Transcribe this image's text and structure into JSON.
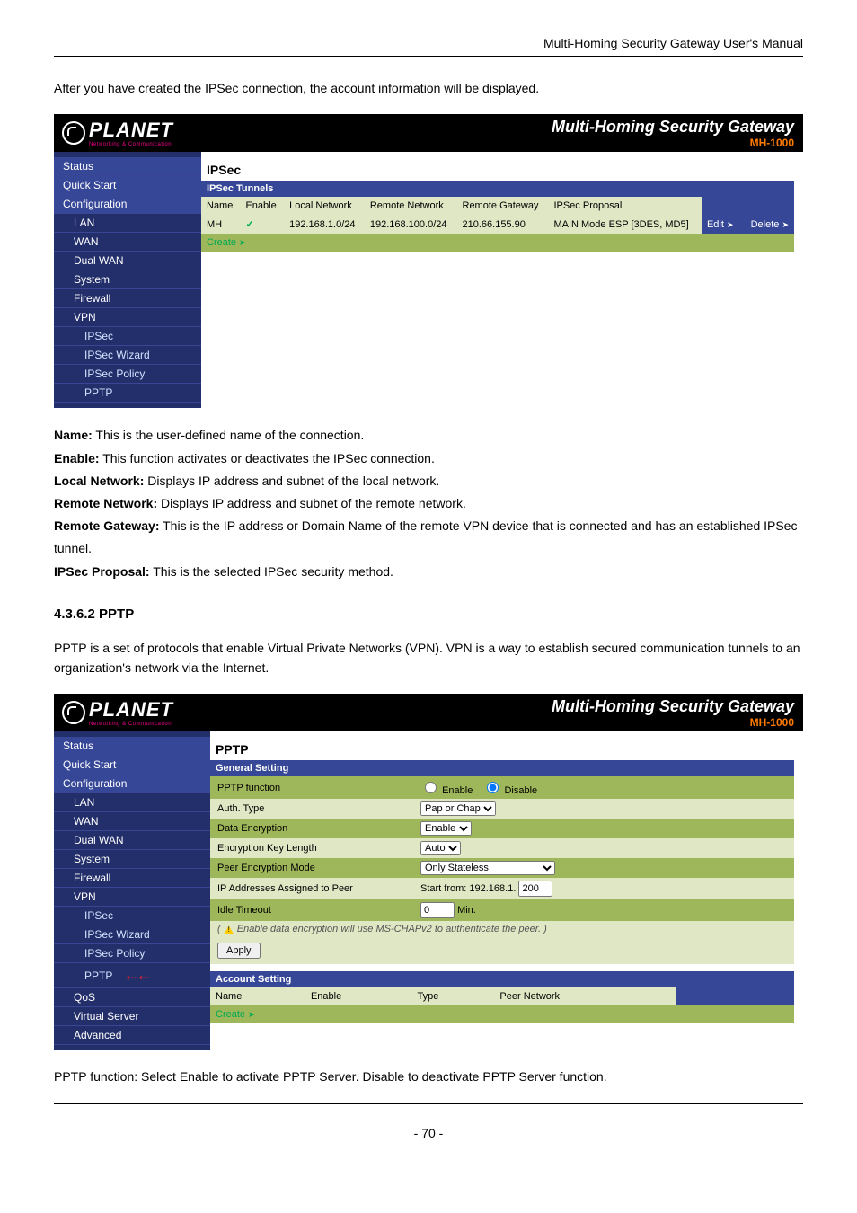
{
  "page_header": "Multi-Homing Security Gateway User's Manual",
  "intro_para": "After you have created the IPSec connection, the account information will be displayed.",
  "app_title": "Multi-Homing Security Gateway",
  "model": "MH-1000",
  "logo_text": "PLANET",
  "logo_sub": "Networking & Communication",
  "sidebar": {
    "status": "Status",
    "quick": "Quick Start",
    "config": "Configuration",
    "lan": "LAN",
    "wan": "WAN",
    "dual": "Dual WAN",
    "system": "System",
    "firewall": "Firewall",
    "vpn": "VPN",
    "ipsec": "IPSec",
    "ipsec_wiz": "IPSec Wizard",
    "ipsec_pol": "IPSec Policy",
    "pptp": "PPTP",
    "qos": "QoS",
    "vserver": "Virtual Server",
    "advanced": "Advanced"
  },
  "ipsec": {
    "title": "IPSec",
    "band": "IPSec Tunnels",
    "headers": {
      "name": "Name",
      "enable": "Enable",
      "lnet": "Local Network",
      "rnet": "Remote Network",
      "rgw": "Remote Gateway",
      "prop": "IPSec Proposal"
    },
    "row": {
      "name": "MH",
      "lnet": "192.168.1.0/24",
      "rnet": "192.168.100.0/24",
      "rgw": "210.66.155.90",
      "prop": "MAIN Mode ESP [3DES, MD5]",
      "edit": "Edit",
      "del": "Delete"
    },
    "create": "Create"
  },
  "defs": {
    "name_k": "Name:",
    "name_v": " This is the user-defined name of the connection.",
    "enable_k": "Enable:",
    "enable_v": " This function activates or deactivates the IPSec connection.",
    "lnet_k": "Local Network:",
    "lnet_v": " Displays IP address and subnet of the local network.",
    "rnet_k": "Remote Network:",
    "rnet_v": " Displays IP address and subnet of the remote network.",
    "rgw_k": "Remote Gateway:",
    "rgw_v": " This is the IP address or Domain Name of the remote VPN device that is connected and has an established IPSec tunnel.",
    "prop_k": "IPSec Proposal:",
    "prop_v": " This is the selected IPSec security method."
  },
  "section_4_3_6_2": "4.3.6.2 PPTP",
  "pptp_para": "PPTP is a set of protocols that enable Virtual Private Networks (VPN). VPN is a way to establish secured communication tunnels to an organization's network via the Internet.",
  "pptp": {
    "title": "PPTP",
    "general": "General Setting",
    "rows": {
      "func": "PPTP function",
      "enable": "Enable",
      "disable": "Disable",
      "auth": "Auth. Type",
      "auth_val": "Pap or Chap",
      "denc": "Data Encryption",
      "denc_val": "Enable",
      "klen": "Encryption Key Length",
      "klen_val": "Auto",
      "pmode": "Peer Encryption Mode",
      "pmode_val": "Only Stateless",
      "ipaddr": "IP Addresses Assigned to Peer",
      "ipaddr_prefix": "Start from: 192.168.1.",
      "ipaddr_val": "200",
      "idle": "Idle Timeout",
      "idle_val": "0",
      "idle_unit": "Min."
    },
    "note": "Enable data encryption will use MS-CHAPv2 to authenticate the peer.",
    "apply": "Apply",
    "account": "Account Setting",
    "acct_headers": {
      "name": "Name",
      "enable": "Enable",
      "type": "Type",
      "peer": "Peer Network"
    },
    "create": "Create"
  },
  "pptp_def": {
    "k": "PPTP function:",
    "pre": " Select ",
    "en": "Enable",
    "mid": " to activate PPTP Server. ",
    "dis": "Disable ",
    "post": "to deactivate PPTP Server function."
  },
  "footer": "- 70 -"
}
